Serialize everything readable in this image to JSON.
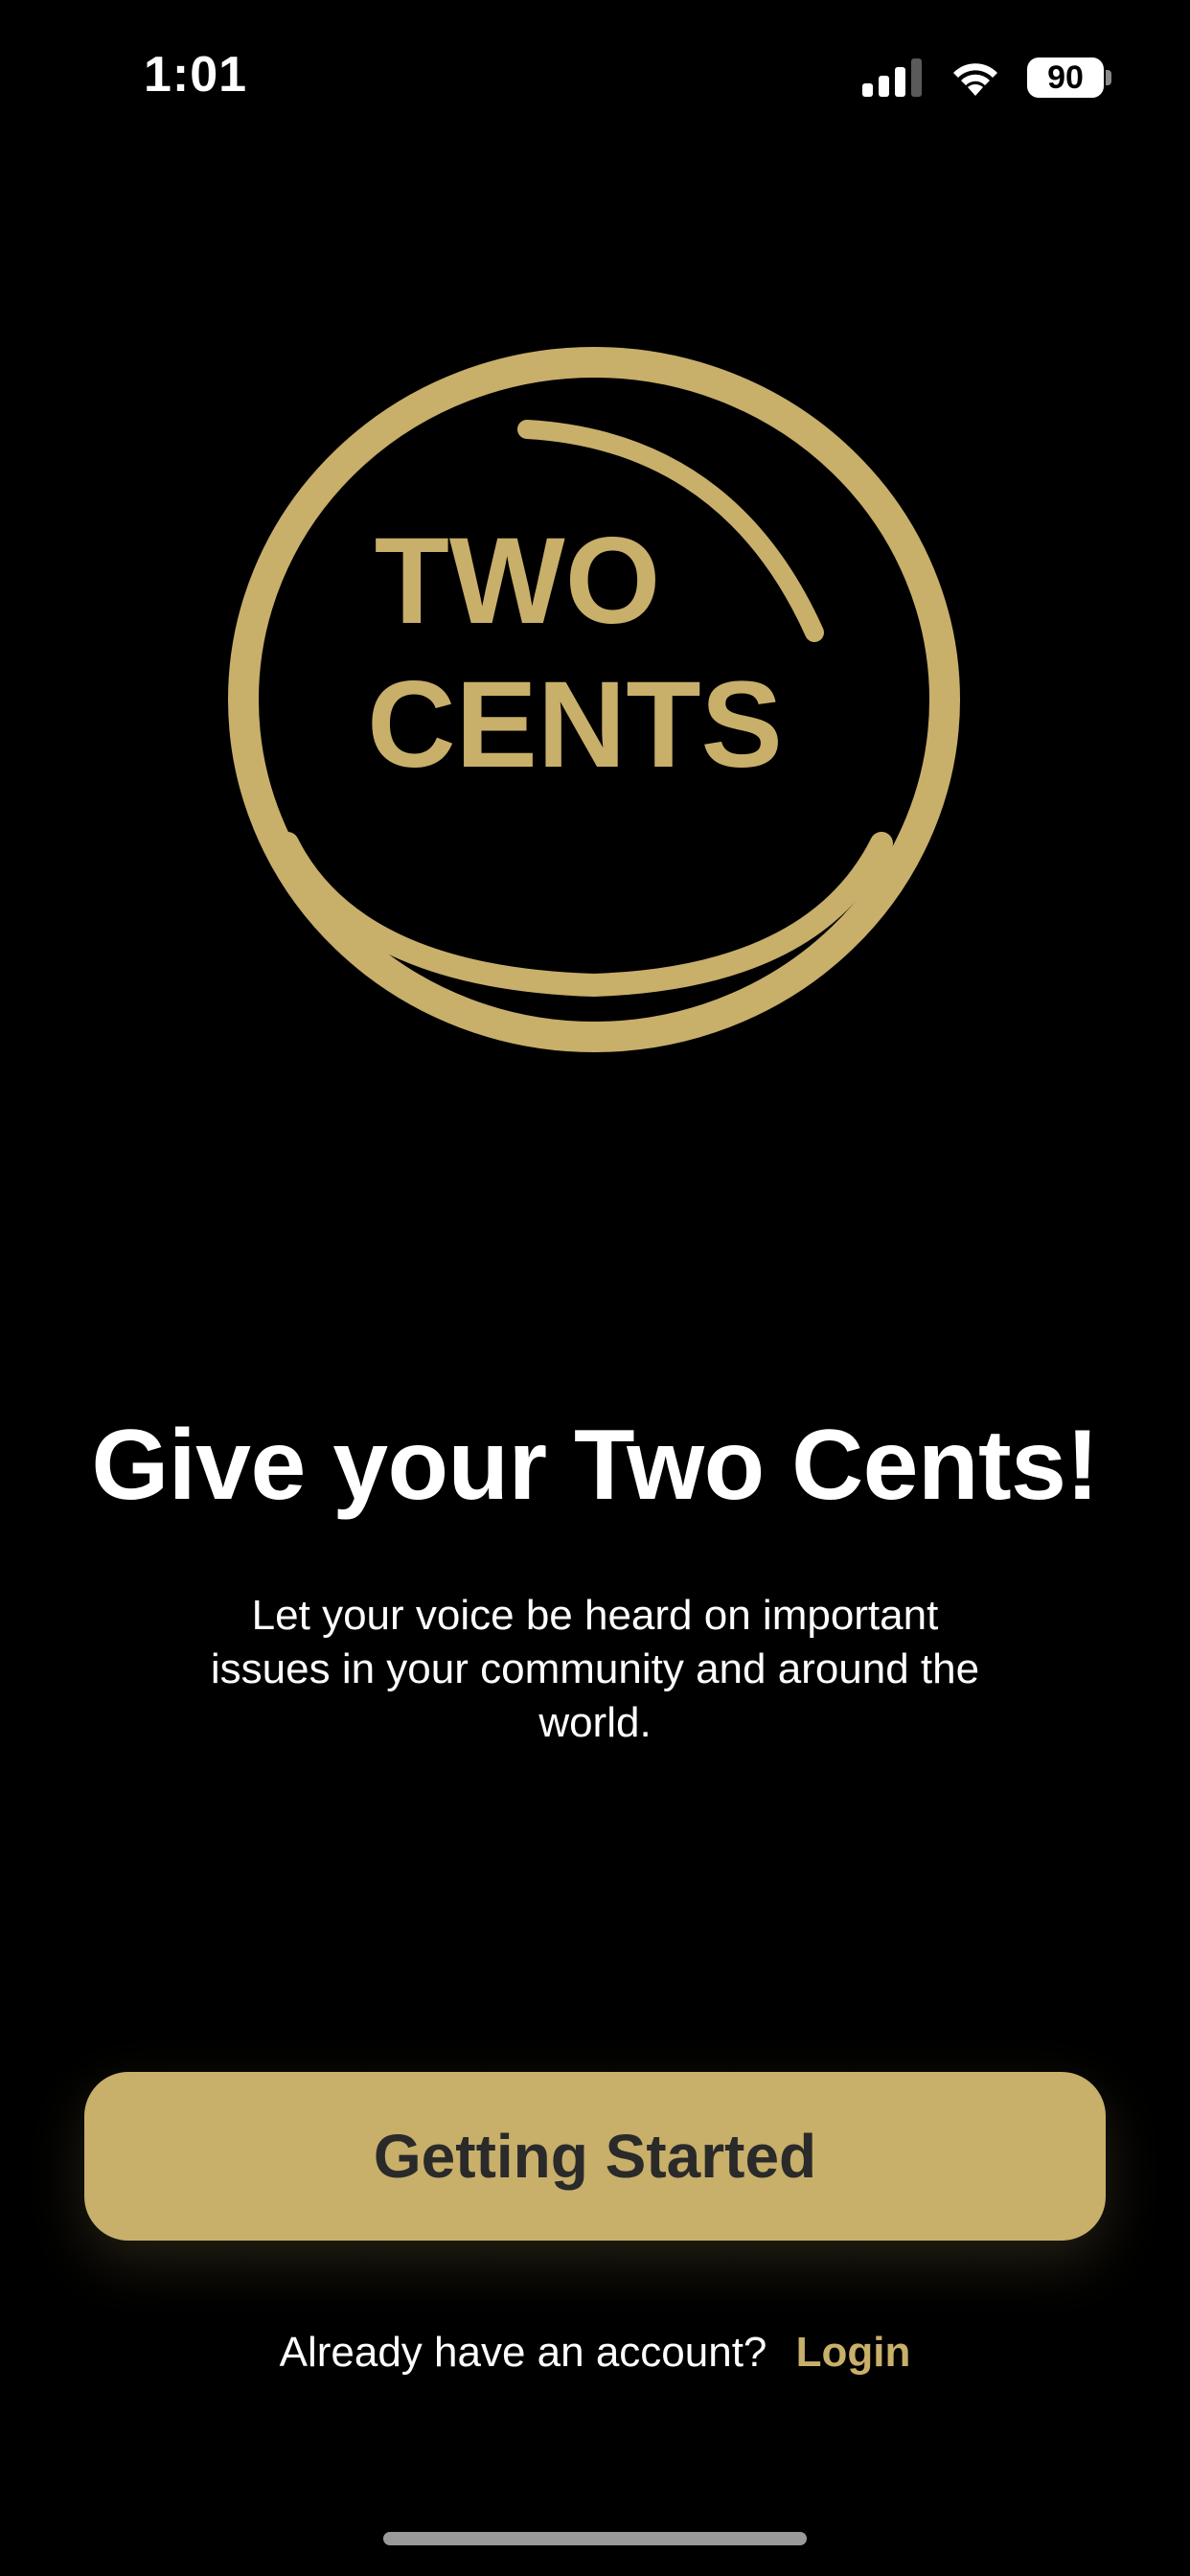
{
  "status_bar": {
    "time": "1:01",
    "battery_level": "90",
    "signal_strength_bars": 3,
    "signal_total_bars": 4,
    "icons": [
      "signal-icon",
      "wifi-icon",
      "battery-icon"
    ]
  },
  "logo": {
    "lines": [
      "TWO",
      "CENTS"
    ],
    "color": "#c8af6a"
  },
  "hero": {
    "headline": "Give your Two Cents!",
    "subtitle_lines": [
      "Let your voice be heard on important",
      "issues in your community and around the",
      "world."
    ]
  },
  "actions": {
    "primary_button_label": "Getting Started",
    "login_prompt": "Already have an account?",
    "login_link_label": "Login"
  },
  "colors": {
    "background": "#000000",
    "accent_gold": "#c8af6a",
    "button_text": "#2a2a2a",
    "text": "#ffffff"
  }
}
